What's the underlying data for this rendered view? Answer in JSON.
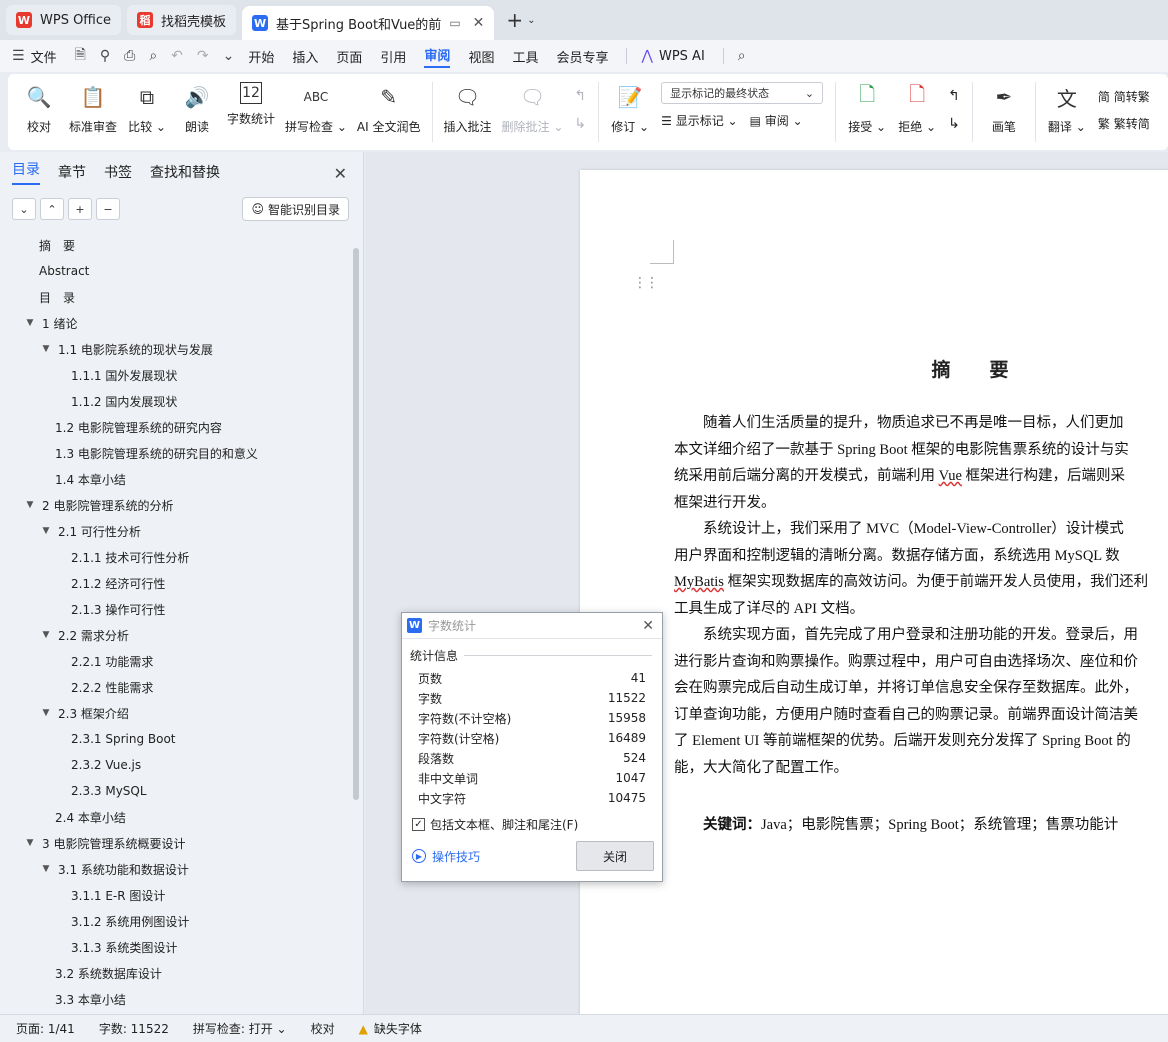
{
  "tabs": [
    {
      "label": "WPS Office",
      "logo": "W",
      "color": "#e8392f"
    },
    {
      "label": "找稻壳模板",
      "logo": "稻",
      "color": "#e8392f"
    },
    {
      "label": "基于Spring Boot和Vue的前",
      "logo": "W",
      "color": "#2b6cf3",
      "active": true
    }
  ],
  "menu": {
    "file": "文件",
    "items": [
      "开始",
      "插入",
      "页面",
      "引用",
      "审阅",
      "视图",
      "工具",
      "会员专享"
    ],
    "active": "审阅",
    "wps_ai": "WPS AI"
  },
  "ribbon": {
    "proof": "校对",
    "std_review": "标准审查",
    "compare": "比较",
    "read_aloud": "朗读",
    "word_count": "字数统计",
    "spell_check": "拼写检查",
    "ai_polish": "AI 全文润色",
    "insert_comment": "插入批注",
    "delete_comment": "删除批注",
    "revise": "修订",
    "markup_state": "显示标记的最终状态",
    "show_markup": "显示标记",
    "review": "审阅",
    "accept": "接受",
    "reject": "拒绝",
    "pen": "画笔",
    "translate": "翻译",
    "to_traditional": "简转繁",
    "to_simplified": "繁转简"
  },
  "pane": {
    "tabs": [
      "目录",
      "章节",
      "书签",
      "查找和替换"
    ],
    "active_tab": "目录",
    "smart_toc": "智能识别目录"
  },
  "toc": [
    {
      "text": "摘　要",
      "level": 0,
      "arrow": ""
    },
    {
      "text": "Abstract",
      "level": 0,
      "arrow": ""
    },
    {
      "text": "目　录",
      "level": 0,
      "arrow": ""
    },
    {
      "text": "1  绪论",
      "level": 0,
      "arrow": "▼"
    },
    {
      "text": "1.1  电影院系统的现状与发展",
      "level": 1,
      "arrow": "▼"
    },
    {
      "text": "1.1.1  国外发展现状",
      "level": 2,
      "arrow": ""
    },
    {
      "text": "1.1.2  国内发展现状",
      "level": 2,
      "arrow": ""
    },
    {
      "text": "1.2 电影院管理系统的研究内容",
      "level": 1,
      "arrow": ""
    },
    {
      "text": "1.3  电影院管理系统的研究目的和意义",
      "level": 1,
      "arrow": ""
    },
    {
      "text": "1.4  本章小结",
      "level": 1,
      "arrow": ""
    },
    {
      "text": "2  电影院管理系统的分析",
      "level": 0,
      "arrow": "▼"
    },
    {
      "text": "2.1  可行性分析",
      "level": 1,
      "arrow": "▼"
    },
    {
      "text": "2.1.1  技术可行性分析",
      "level": 2,
      "arrow": ""
    },
    {
      "text": "2.1.2  经济可行性",
      "level": 2,
      "arrow": ""
    },
    {
      "text": "2.1.3  操作可行性",
      "level": 2,
      "arrow": ""
    },
    {
      "text": "2.2  需求分析",
      "level": 1,
      "arrow": "▼"
    },
    {
      "text": "2.2.1  功能需求",
      "level": 2,
      "arrow": ""
    },
    {
      "text": "2.2.2  性能需求",
      "level": 2,
      "arrow": ""
    },
    {
      "text": "2.3  框架介绍",
      "level": 1,
      "arrow": "▼"
    },
    {
      "text": "2.3.1 Spring Boot",
      "level": 2,
      "arrow": ""
    },
    {
      "text": "2.3.2 Vue.js",
      "level": 2,
      "arrow": ""
    },
    {
      "text": "2.3.3 MySQL",
      "level": 2,
      "arrow": ""
    },
    {
      "text": "2.4  本章小结",
      "level": 1,
      "arrow": ""
    },
    {
      "text": "3  电影院管理系统概要设计",
      "level": 0,
      "arrow": "▼"
    },
    {
      "text": "3.1  系统功能和数据设计",
      "level": 1,
      "arrow": "▼"
    },
    {
      "text": "3.1.1 E-R 图设计",
      "level": 2,
      "arrow": ""
    },
    {
      "text": "3.1.2  系统用例图设计",
      "level": 2,
      "arrow": ""
    },
    {
      "text": "3.1.3  系统类图设计",
      "level": 2,
      "arrow": ""
    },
    {
      "text": "3.2  系统数据库设计",
      "level": 1,
      "arrow": ""
    },
    {
      "text": "3.3  本章小结",
      "level": 1,
      "arrow": ""
    }
  ],
  "doc": {
    "title": "摘　要",
    "lines": [
      "　　随着人们生活质量的提升，物质追求已不再是唯一目标，人们更加",
      "本文详细介绍了一款基于 Spring Boot 框架的电影院售票系统的设计与实",
      "统采用前后端分离的开发模式，前端利用 Vue 框架进行构建，后端则采",
      "框架进行开发。",
      "　　系统设计上，我们采用了 MVC（Model-View-Controller）设计模式",
      "用户界面和控制逻辑的清晰分离。数据存储方面，系统选用 MySQL 数",
      "MyBatis 框架实现数据库的高效访问。为便于前端开发人员使用，我们还利",
      "工具生成了详尽的 API 文档。",
      "　　系统实现方面，首先完成了用户登录和注册功能的开发。登录后，用",
      "进行影片查询和购票操作。购票过程中，用户可自由选择场次、座位和价",
      "会在购票完成后自动生成订单，并将订单信息安全保存至数据库。此外，",
      "订单查询功能，方便用户随时查看自己的购票记录。前端界面设计简洁美",
      "了 Element UI 等前端框架的优势。后端开发则充分发挥了 Spring Boot 的",
      "能，大大简化了配置工作。"
    ],
    "keywords_label": "关键词：",
    "keywords": "Java；电影院售票；Spring Boot；系统管理；售票功能计"
  },
  "dialog": {
    "title": "字数统计",
    "section": "统计信息",
    "rows": [
      {
        "label": "页数",
        "value": "41"
      },
      {
        "label": "字数",
        "value": "11522"
      },
      {
        "label": "字符数(不计空格)",
        "value": "15958"
      },
      {
        "label": "字符数(计空格)",
        "value": "16489"
      },
      {
        "label": "段落数",
        "value": "524"
      },
      {
        "label": "非中文单词",
        "value": "1047"
      },
      {
        "label": "中文字符",
        "value": "10475"
      }
    ],
    "include_label": "包括文本框、脚注和尾注(F)",
    "tips": "操作技巧",
    "close": "关闭"
  },
  "status": {
    "page": "页面: 1/41",
    "words": "字数: 11522",
    "spell": "拼写检查: 打开",
    "proof": "校对",
    "missing_font": "缺失字体"
  }
}
